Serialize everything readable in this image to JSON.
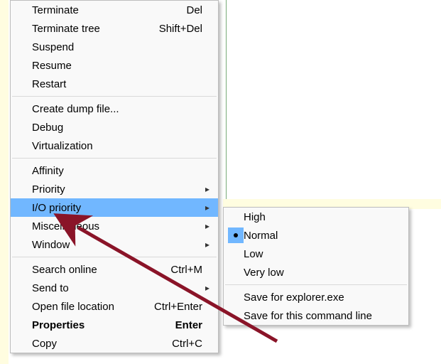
{
  "main_menu": {
    "groups": [
      [
        {
          "label": "Terminate",
          "accel": "Del",
          "submenu": false,
          "hl": false,
          "bold": false
        },
        {
          "label": "Terminate tree",
          "accel": "Shift+Del",
          "submenu": false,
          "hl": false,
          "bold": false
        },
        {
          "label": "Suspend",
          "accel": "",
          "submenu": false,
          "hl": false,
          "bold": false
        },
        {
          "label": "Resume",
          "accel": "",
          "submenu": false,
          "hl": false,
          "bold": false
        },
        {
          "label": "Restart",
          "accel": "",
          "submenu": false,
          "hl": false,
          "bold": false
        }
      ],
      [
        {
          "label": "Create dump file...",
          "accel": "",
          "submenu": false,
          "hl": false,
          "bold": false
        },
        {
          "label": "Debug",
          "accel": "",
          "submenu": false,
          "hl": false,
          "bold": false
        },
        {
          "label": "Virtualization",
          "accel": "",
          "submenu": false,
          "hl": false,
          "bold": false
        }
      ],
      [
        {
          "label": "Affinity",
          "accel": "",
          "submenu": false,
          "hl": false,
          "bold": false
        },
        {
          "label": "Priority",
          "accel": "",
          "submenu": true,
          "hl": false,
          "bold": false
        },
        {
          "label": "I/O priority",
          "accel": "",
          "submenu": true,
          "hl": true,
          "bold": false
        },
        {
          "label": "Miscellaneous",
          "accel": "",
          "submenu": true,
          "hl": false,
          "bold": false
        },
        {
          "label": "Window",
          "accel": "",
          "submenu": true,
          "hl": false,
          "bold": false
        }
      ],
      [
        {
          "label": "Search online",
          "accel": "Ctrl+M",
          "submenu": false,
          "hl": false,
          "bold": false
        },
        {
          "label": "Send to",
          "accel": "",
          "submenu": true,
          "hl": false,
          "bold": false
        },
        {
          "label": "Open file location",
          "accel": "Ctrl+Enter",
          "submenu": false,
          "hl": false,
          "bold": false
        },
        {
          "label": "Properties",
          "accel": "Enter",
          "submenu": false,
          "hl": false,
          "bold": true
        },
        {
          "label": "Copy",
          "accel": "Ctrl+C",
          "submenu": false,
          "hl": false,
          "bold": false
        }
      ]
    ]
  },
  "sub_menu": {
    "groups": [
      [
        {
          "label": "High",
          "selected": false
        },
        {
          "label": "Normal",
          "selected": true
        },
        {
          "label": "Low",
          "selected": false
        },
        {
          "label": "Very low",
          "selected": false
        }
      ],
      [
        {
          "label": "Save for explorer.exe",
          "selected": false
        },
        {
          "label": "Save for this command line",
          "selected": false
        }
      ]
    ]
  },
  "chevron_glyph": "▸",
  "annotation": {
    "type": "pointer-arrow",
    "color": "#8a1428"
  }
}
